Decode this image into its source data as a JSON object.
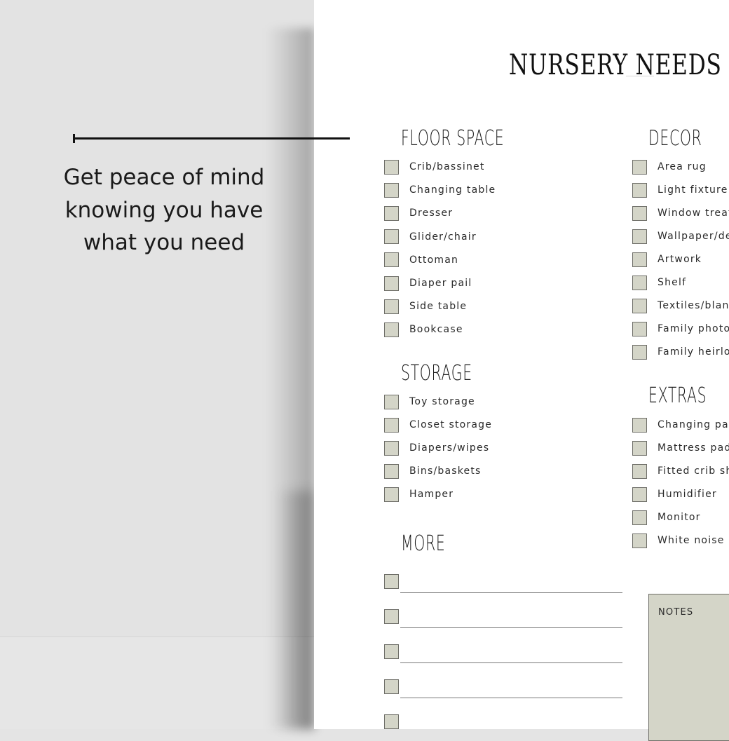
{
  "tagline": "Get peace of mind knowing you have what you need",
  "sheet": {
    "title": "NURSERY NEEDS",
    "sections": {
      "floor_space": {
        "heading": "FLOOR SPACE",
        "items": [
          "Crib/bassinet",
          "Changing table",
          "Dresser",
          "Glider/chair",
          "Ottoman",
          "Diaper pail",
          "Side table",
          "Bookcase"
        ]
      },
      "storage": {
        "heading": "STORAGE",
        "items": [
          "Toy storage",
          "Closet storage",
          "Diapers/wipes",
          "Bins/baskets",
          "Hamper"
        ]
      },
      "more": {
        "heading": "MORE",
        "blank_lines": 5
      },
      "decor": {
        "heading": "DECOR",
        "items": [
          "Area rug",
          "Light fixture",
          "Window treat",
          "Wallpaper/de",
          "Artwork",
          "Shelf",
          "Textiles/blan",
          "Family photo",
          "Family heirlo"
        ]
      },
      "extras": {
        "heading": "EXTRAS",
        "items": [
          "Changing pad",
          "Mattress pad",
          "Fitted crib sh",
          "Humidifier",
          "Monitor",
          "White noise m"
        ]
      }
    },
    "notes_label": "NOTES"
  },
  "colors": {
    "checkbox_fill": "#d4d5c8",
    "checkbox_border": "#6e6e68",
    "backdrop": "#e3e3e3",
    "text": "#1a1a1a"
  }
}
